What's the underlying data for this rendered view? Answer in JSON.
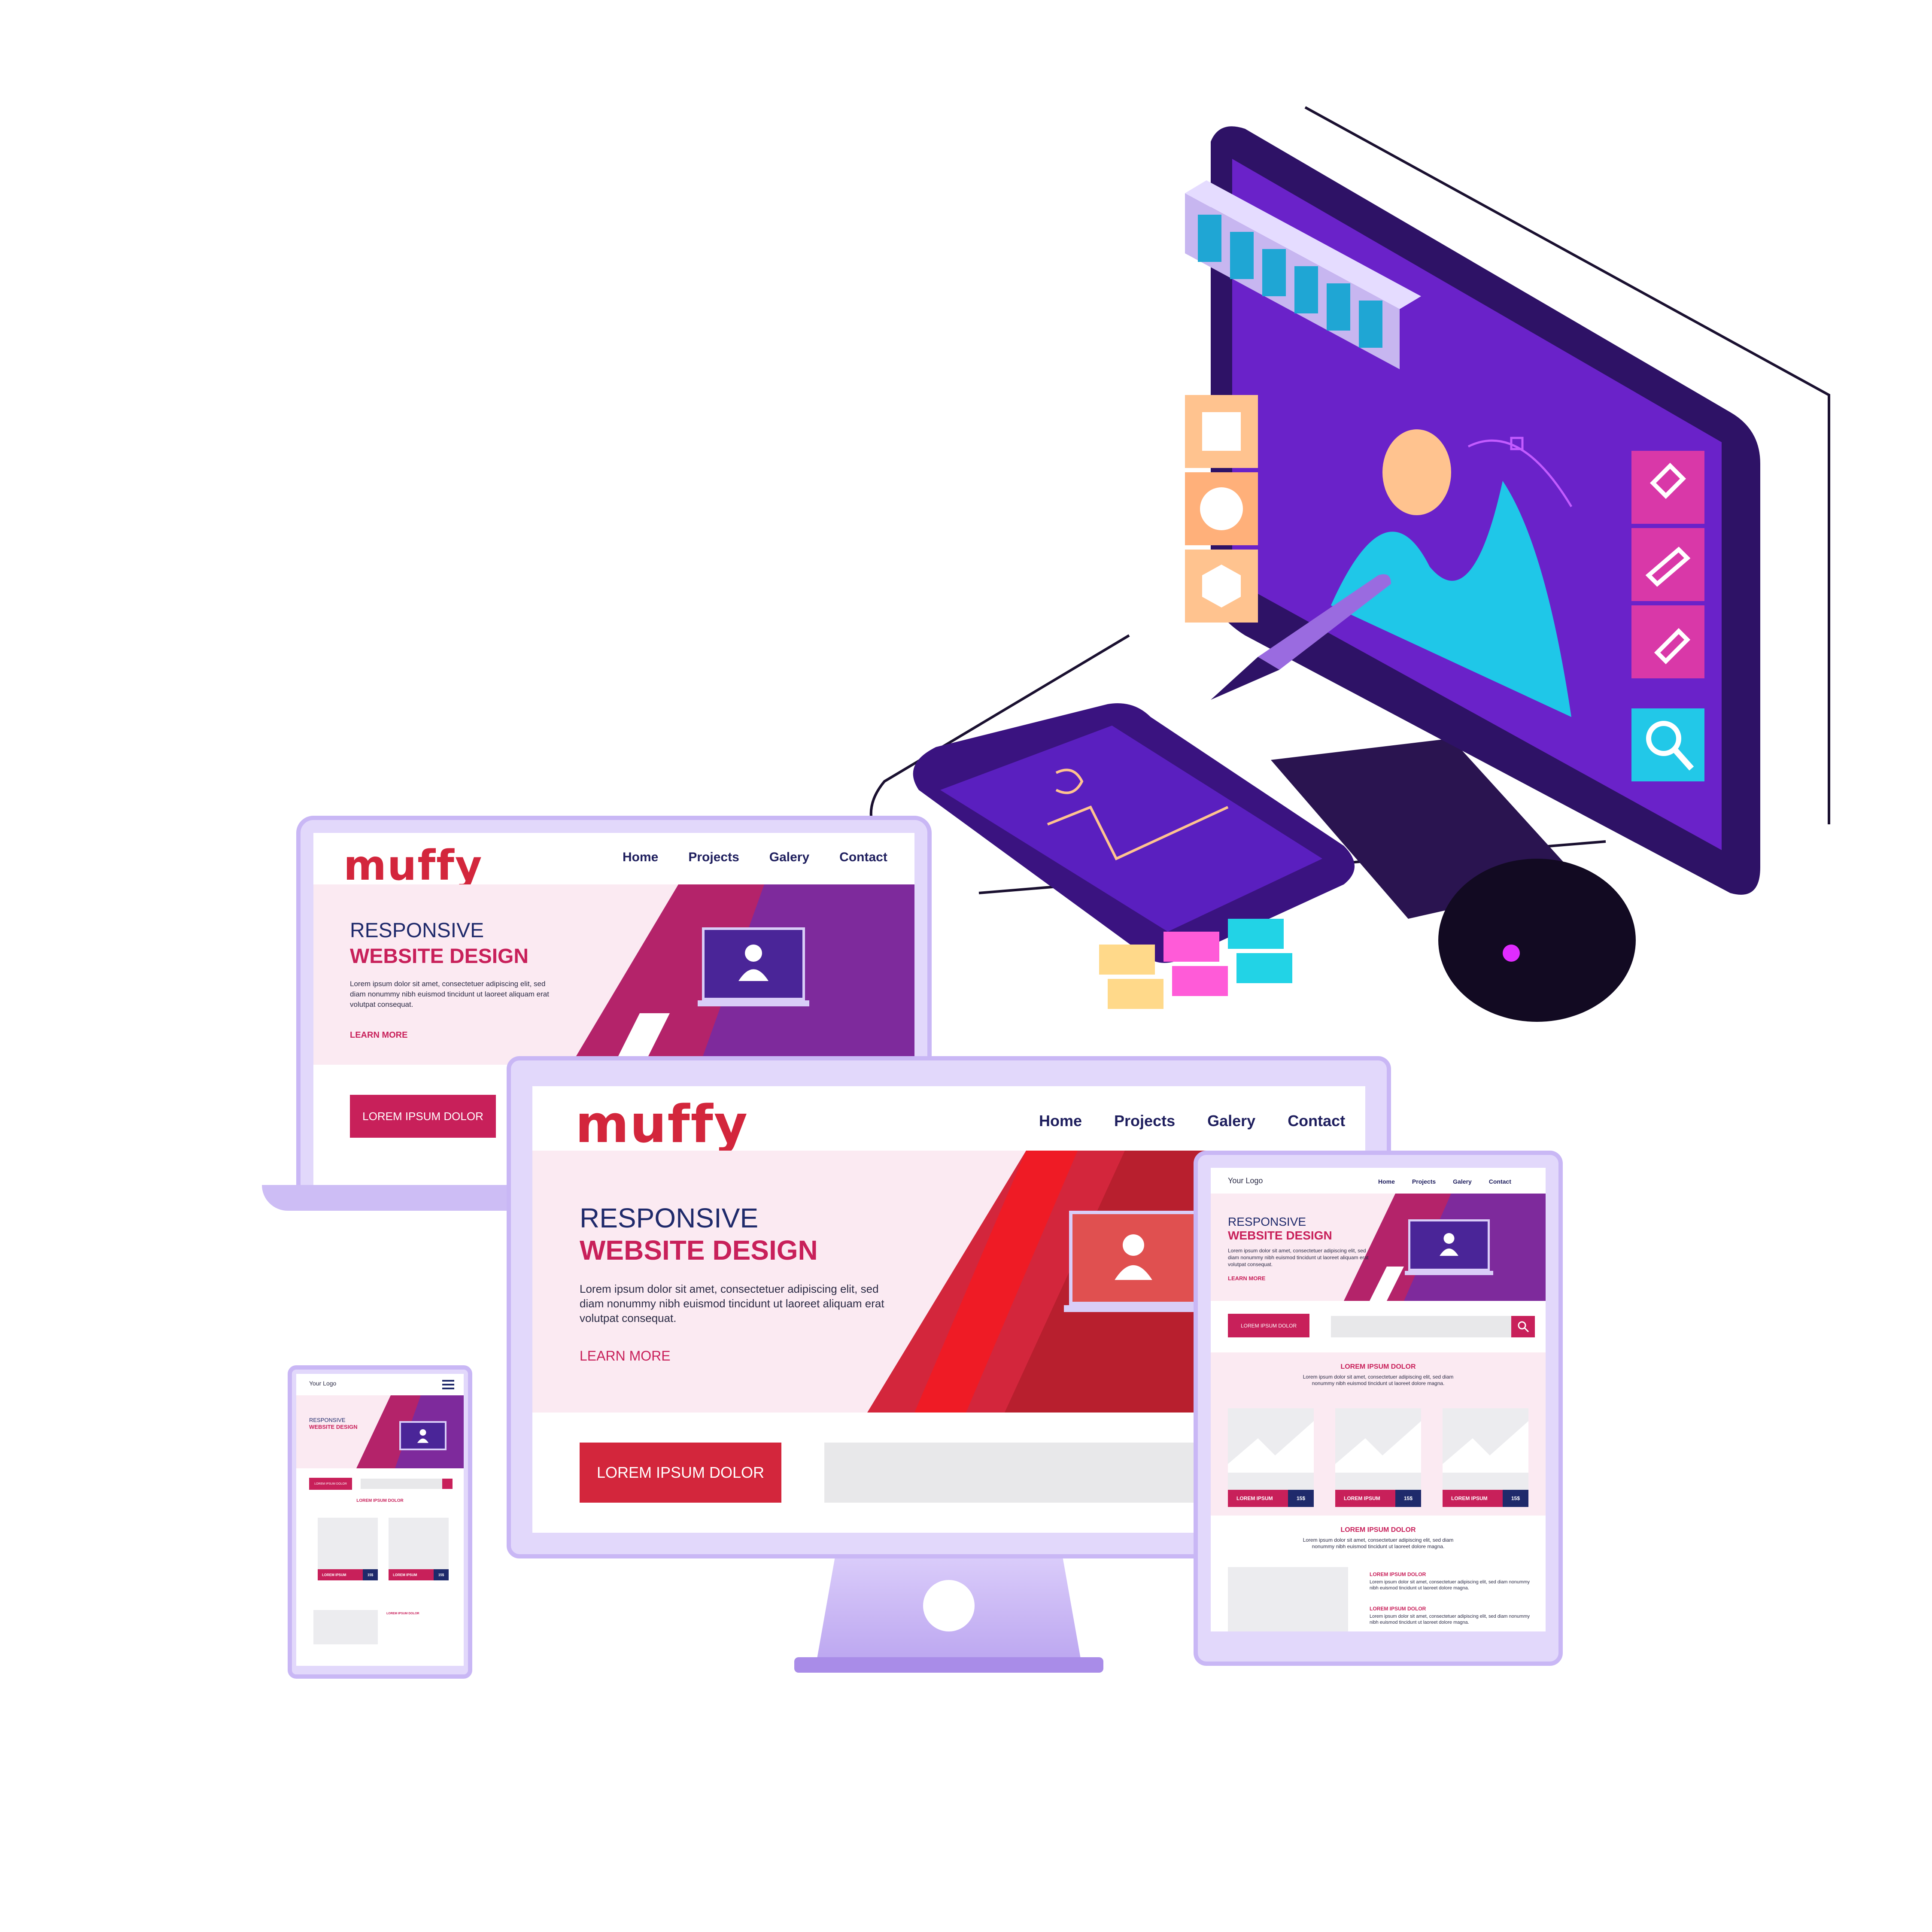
{
  "brand": {
    "logo": "muffy",
    "small_logo": "Your Logo"
  },
  "nav": [
    "Home",
    "Projects",
    "Galery",
    "Contact"
  ],
  "hero": {
    "line1": "RESPONSIVE",
    "line2": "WEBSITE DESIGN",
    "body": "Lorem ipsum dolor sit amet, consectetuer adipiscing elit, sed diam nonummy nibh euismod tincidunt ut laoreet aliquam erat volutpat consequat.",
    "learn_more": "LEARN MORE"
  },
  "cta": "LOREM IPSUM DOLOR",
  "section": {
    "title": "LOREM IPSUM DOLOR",
    "body": "Lorem ipsum dolor sit amet, consectetuer adipiscing elit, sed diam nonummy nibh euismod tincidunt ut laoreet dolore magna."
  },
  "card": {
    "label": "LOREM IPSUM",
    "price": "15$"
  },
  "colors": {
    "accent": "#c8205a",
    "red": "#d3263c",
    "navy": "#1f2a6b",
    "purple": "#6a22c9",
    "frame": "#c9b7f5",
    "cyan": "#22d3e6",
    "peach": "#ffc38f"
  },
  "icons": [
    "user-icon",
    "search-icon",
    "menu-icon",
    "pen-tool-icon",
    "pencil-icon",
    "eyedropper-icon",
    "magnifier-icon",
    "mountain-image-icon"
  ]
}
